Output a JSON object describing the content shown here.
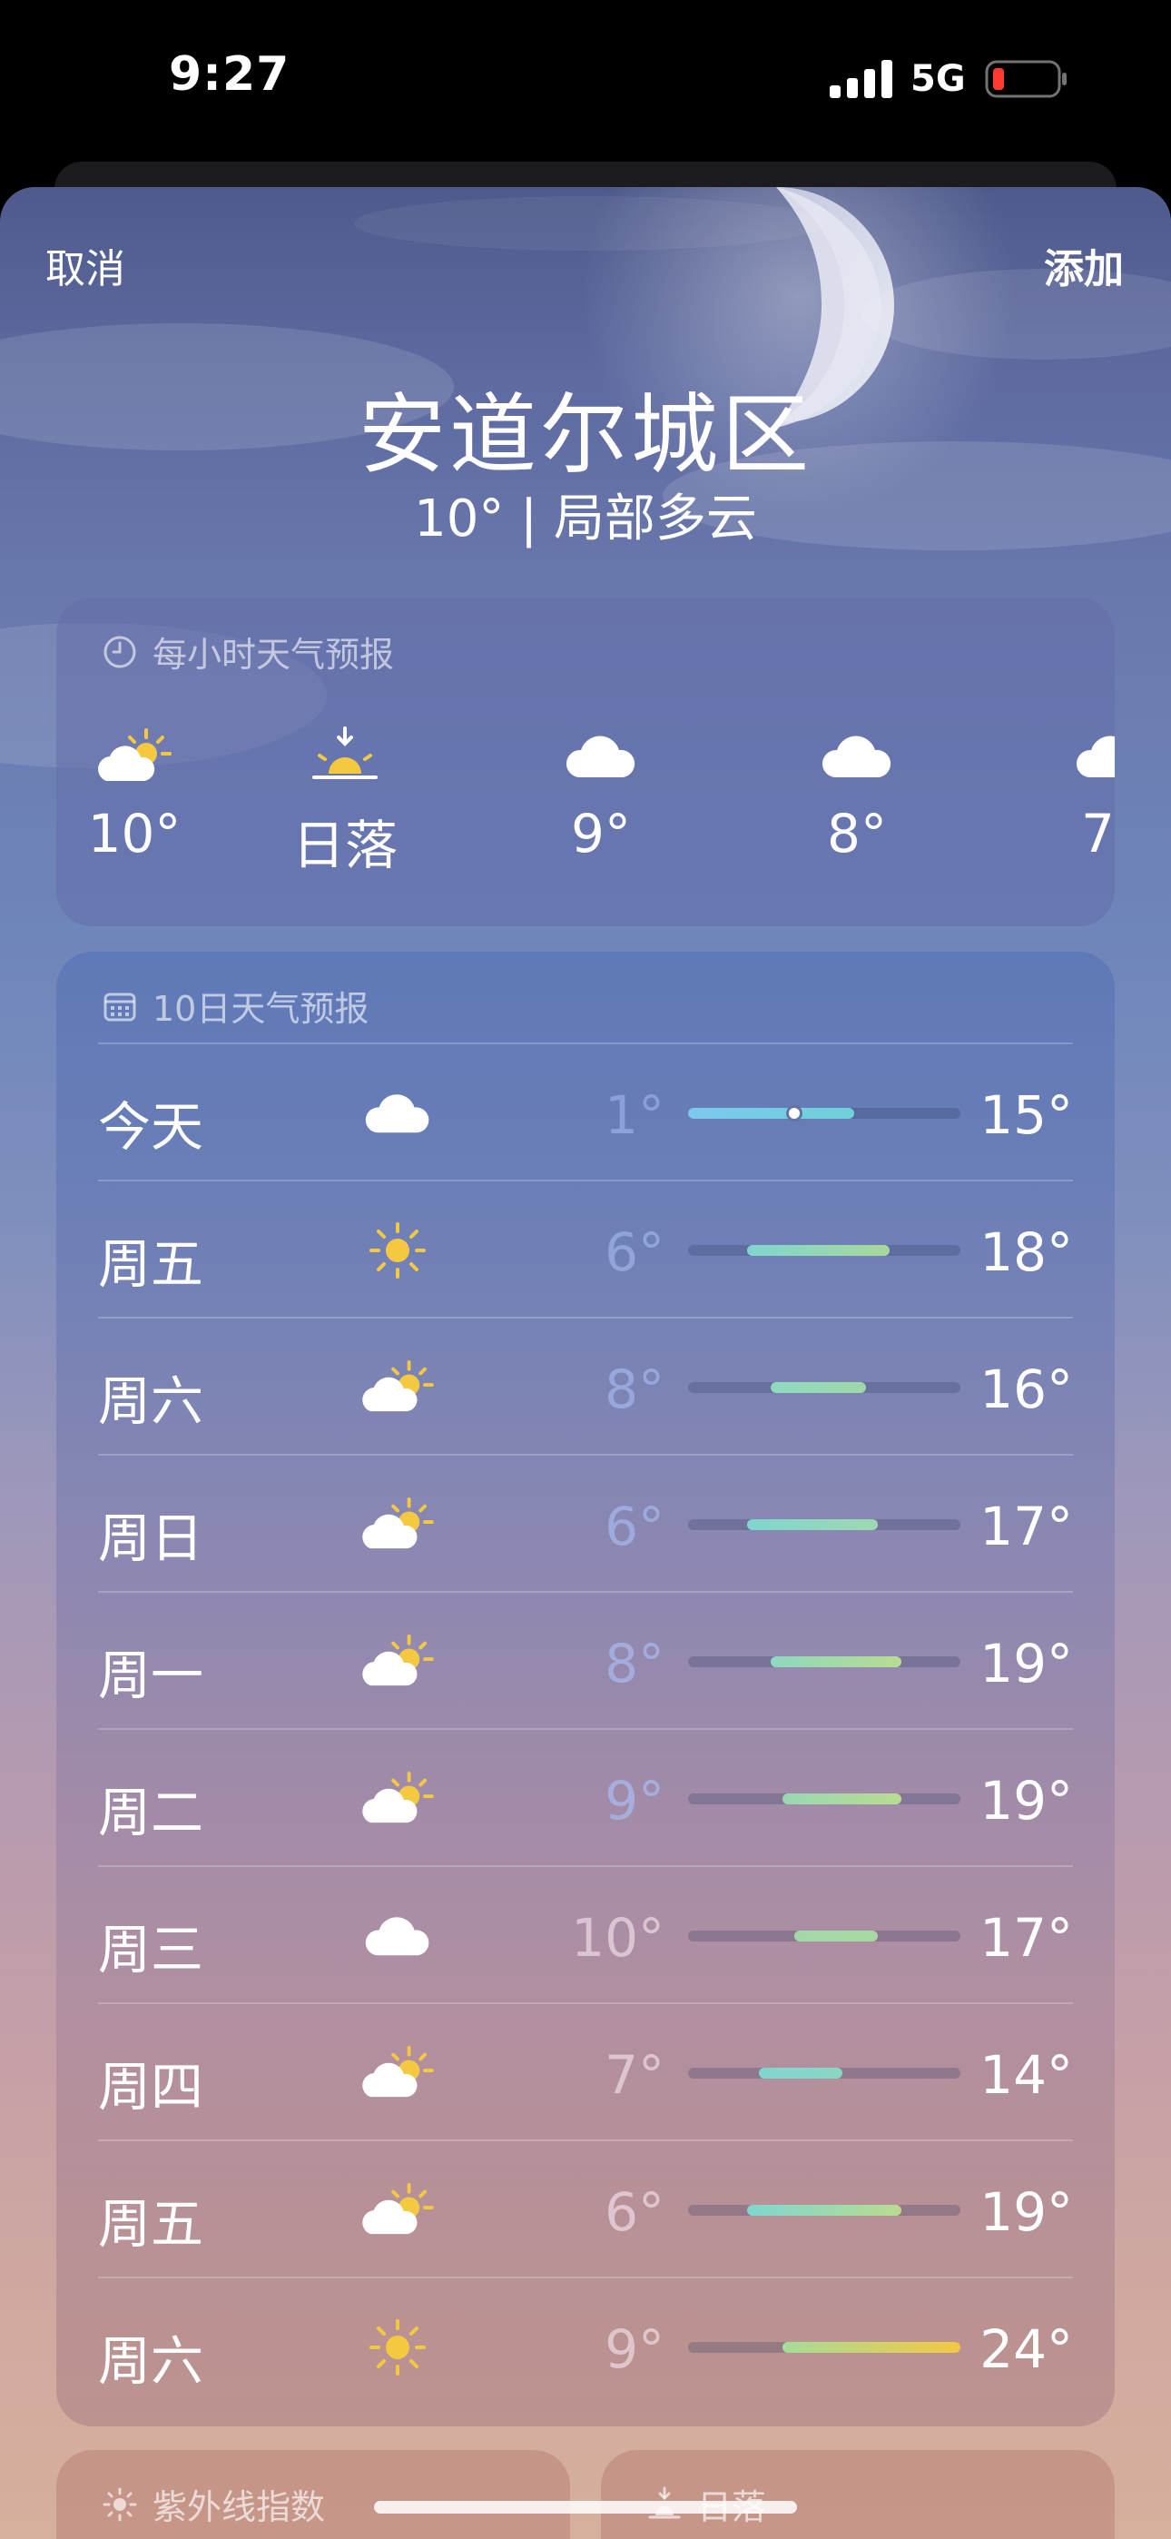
{
  "status_bar": {
    "time": "9:27",
    "network": "5G",
    "signal_icon": "signal-bars-icon",
    "battery_icon": "battery-low-icon",
    "battery_color": "#ff3b30"
  },
  "nav": {
    "cancel_label": "取消",
    "add_label": "添加"
  },
  "location": {
    "name": "安道尔城区",
    "conditions": "10° | 局部多云"
  },
  "hourly": {
    "title": "每小时天气预报",
    "icon": "clock-icon",
    "items": [
      {
        "label": "10°",
        "icon": "partly-cloudy-icon"
      },
      {
        "label": "日落",
        "icon": "sunset-icon"
      },
      {
        "label": "9°",
        "icon": "cloud-icon"
      },
      {
        "label": "8°",
        "icon": "cloud-icon"
      },
      {
        "label": "7°",
        "icon": "cloud-icon"
      }
    ]
  },
  "daily": {
    "title": "10日天气预报",
    "icon": "calendar-icon",
    "range_min": 1,
    "range_max": 24,
    "days": [
      {
        "name": "今天",
        "icon": "cloud-icon",
        "low": "1°",
        "high": "15°",
        "low_val": 1,
        "high_val": 15,
        "current_val": 10,
        "colors": [
          "#7cc8ee",
          "#6fd0d8"
        ]
      },
      {
        "name": "周五",
        "icon": "sun-icon",
        "low": "6°",
        "high": "18°",
        "low_val": 6,
        "high_val": 18,
        "colors": [
          "#7fd6d0",
          "#a8d89a"
        ]
      },
      {
        "name": "周六",
        "icon": "partly-cloudy-icon",
        "low": "8°",
        "high": "16°",
        "low_val": 8,
        "high_val": 16,
        "colors": [
          "#8fd8c0",
          "#9fd8a8"
        ]
      },
      {
        "name": "周日",
        "icon": "partly-cloudy-icon",
        "low": "6°",
        "high": "17°",
        "low_val": 6,
        "high_val": 17,
        "colors": [
          "#7fd6d0",
          "#9fd8b0"
        ]
      },
      {
        "name": "周一",
        "icon": "partly-cloudy-icon",
        "low": "8°",
        "high": "19°",
        "low_val": 8,
        "high_val": 19,
        "colors": [
          "#8fd8c0",
          "#b8dc90"
        ]
      },
      {
        "name": "周二",
        "icon": "partly-cloudy-icon",
        "low": "9°",
        "high": "19°",
        "low_val": 9,
        "high_val": 19,
        "colors": [
          "#9ad8b4",
          "#b8dc90"
        ]
      },
      {
        "name": "周三",
        "icon": "cloud-icon",
        "low": "10°",
        "high": "17°",
        "low_val": 10,
        "high_val": 17,
        "colors": [
          "#a2d8aa",
          "#a8d8a0"
        ]
      },
      {
        "name": "周四",
        "icon": "partly-cloudy-icon",
        "low": "7°",
        "high": "14°",
        "low_val": 7,
        "high_val": 14,
        "colors": [
          "#7fd6d0",
          "#8ad6c4"
        ]
      },
      {
        "name": "周五",
        "icon": "partly-cloudy-icon",
        "low": "6°",
        "high": "19°",
        "low_val": 6,
        "high_val": 19,
        "colors": [
          "#7fd6d0",
          "#b8dc90"
        ]
      },
      {
        "name": "周六",
        "icon": "sun-icon",
        "low": "9°",
        "high": "24°",
        "low_val": 9,
        "high_val": 24,
        "colors": [
          "#a6dc9a",
          "#f5c842"
        ]
      }
    ]
  },
  "uv": {
    "title": "紫外线指数",
    "icon": "sun-small-icon"
  },
  "sunset": {
    "title": "日落",
    "icon": "sunset-small-icon"
  }
}
